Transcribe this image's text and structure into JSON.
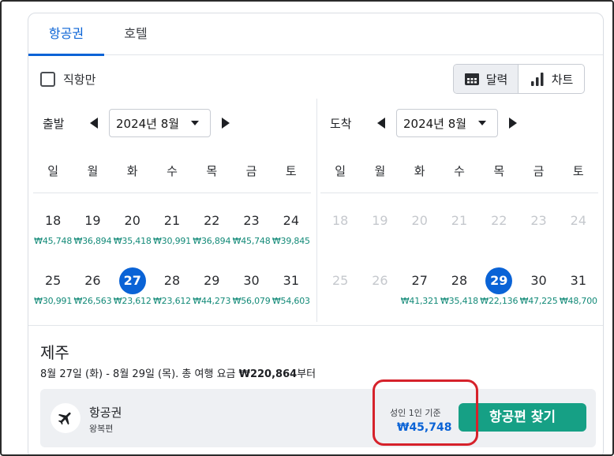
{
  "tabs": [
    {
      "label": "항공권"
    },
    {
      "label": "호텔"
    }
  ],
  "filters": {
    "direct_only_label": "직항만",
    "direct_only_checked": false
  },
  "view_toggle": {
    "calendar_label": "달력",
    "chart_label": "차트",
    "active": "calendar"
  },
  "departure": {
    "label": "출발",
    "month": "2024년 8월",
    "weekdays": [
      "일",
      "월",
      "화",
      "수",
      "목",
      "금",
      "토"
    ],
    "weeks": [
      [
        {
          "day": "18",
          "price": "₩45,748"
        },
        {
          "day": "19",
          "price": "₩36,894"
        },
        {
          "day": "20",
          "price": "₩35,418"
        },
        {
          "day": "21",
          "price": "₩30,991"
        },
        {
          "day": "22",
          "price": "₩36,894"
        },
        {
          "day": "23",
          "price": "₩45,748"
        },
        {
          "day": "24",
          "price": "₩39,845"
        }
      ],
      [
        {
          "day": "25",
          "price": "₩30,991"
        },
        {
          "day": "26",
          "price": "₩26,563"
        },
        {
          "day": "27",
          "price": "₩23,612",
          "selected": true
        },
        {
          "day": "28",
          "price": "₩23,612"
        },
        {
          "day": "29",
          "price": "₩44,273"
        },
        {
          "day": "30",
          "price": "₩56,079"
        },
        {
          "day": "31",
          "price": "₩54,603"
        }
      ]
    ]
  },
  "arrival": {
    "label": "도착",
    "month": "2024년 8월",
    "weekdays": [
      "일",
      "월",
      "화",
      "수",
      "목",
      "금",
      "토"
    ],
    "weeks": [
      [
        {
          "day": "18",
          "price": "",
          "disabled": true
        },
        {
          "day": "19",
          "price": "",
          "disabled": true
        },
        {
          "day": "20",
          "price": "",
          "disabled": true
        },
        {
          "day": "21",
          "price": "",
          "disabled": true
        },
        {
          "day": "22",
          "price": "",
          "disabled": true
        },
        {
          "day": "23",
          "price": "",
          "disabled": true
        },
        {
          "day": "24",
          "price": "",
          "disabled": true
        }
      ],
      [
        {
          "day": "25",
          "price": "",
          "disabled": true
        },
        {
          "day": "26",
          "price": "",
          "disabled": true
        },
        {
          "day": "27",
          "price": "₩41,321"
        },
        {
          "day": "28",
          "price": "₩35,418"
        },
        {
          "day": "29",
          "price": "₩22,136",
          "selected": true
        },
        {
          "day": "30",
          "price": "₩47,225"
        },
        {
          "day": "31",
          "price": "₩48,700"
        }
      ]
    ]
  },
  "summary": {
    "destination": "제주",
    "trip_text": "8월 27일 (화) - 8월 29일 (목). 총 여행 요금 ",
    "trip_total": "₩220,864",
    "trip_suffix": "부터"
  },
  "flight_box": {
    "title": "항공권",
    "subtitle": "왕복편",
    "basis": "성인 1인 기준",
    "price": "₩45,748",
    "button_label": "항공편 찾기"
  },
  "colors": {
    "accent_blue": "#0a63d6",
    "price_green": "#138a78",
    "button_green": "#16a085",
    "highlight_red": "#d6222b"
  }
}
